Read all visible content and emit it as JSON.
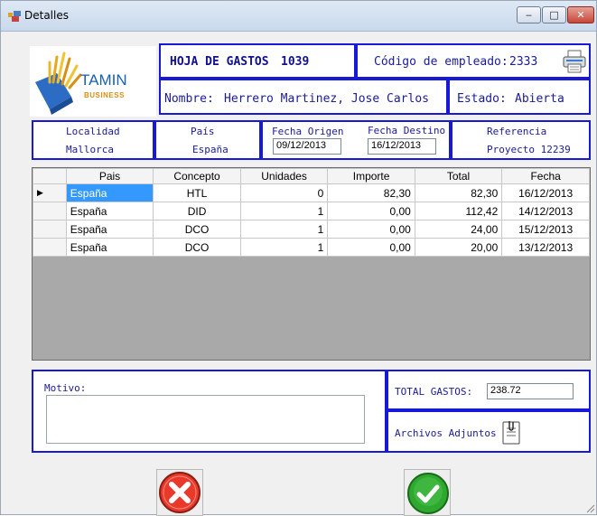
{
  "window": {
    "title": "Detalles",
    "min_glyph": "‒",
    "max_glyph": "□",
    "close_glyph": "✕"
  },
  "header": {
    "logo_text": "TAMIN",
    "logo_subtext": "BUSINESS",
    "sheet_label": "HOJA DE GASTOS",
    "sheet_number": "1039",
    "employee_code_label": "Código de empleado:",
    "employee_code": "2333",
    "name_label": "Nombre:",
    "name_value": "Herrero Martinez, Jose Carlos",
    "status_label": "Estado:",
    "status_value": "Abierta"
  },
  "info": {
    "locality_label": "Localidad",
    "locality_value": "Mallorca",
    "country_label": "País",
    "country_value": "España",
    "date_from_label": "Fecha Origen",
    "date_from_value": "09/12/2013",
    "date_to_label": "Fecha Destino",
    "date_to_value": "16/12/2013",
    "reference_label": "Referencia",
    "reference_value": "Proyecto 12239"
  },
  "grid": {
    "columns": [
      "Pais",
      "Concepto",
      "Unidades",
      "Importe",
      "Total",
      "Fecha"
    ],
    "rows": [
      [
        "España",
        "HTL",
        "0",
        "82,30",
        "82,30",
        "16/12/2013"
      ],
      [
        "España",
        "DID",
        "1",
        "0,00",
        "112,42",
        "14/12/2013"
      ],
      [
        "España",
        "DCO",
        "1",
        "0,00",
        "24,00",
        "15/12/2013"
      ],
      [
        "España",
        "DCO",
        "1",
        "0,00",
        "20,00",
        "13/12/2013"
      ]
    ],
    "current_row_marker": "▶"
  },
  "footer": {
    "motivo_label": "Motivo:",
    "motivo_value": "",
    "total_label": "TOTAL GASTOS:",
    "total_value": "238.72",
    "attachments_label": "Archivos Adjuntos"
  },
  "colors": {
    "accent": "#1818d8",
    "label_text": "#1a1a9a",
    "selection": "#3399ff",
    "cancel": "#e8392b",
    "ok": "#2fa82f"
  },
  "icons": [
    "printer-icon",
    "attachment-icon",
    "cancel-icon",
    "ok-icon"
  ]
}
